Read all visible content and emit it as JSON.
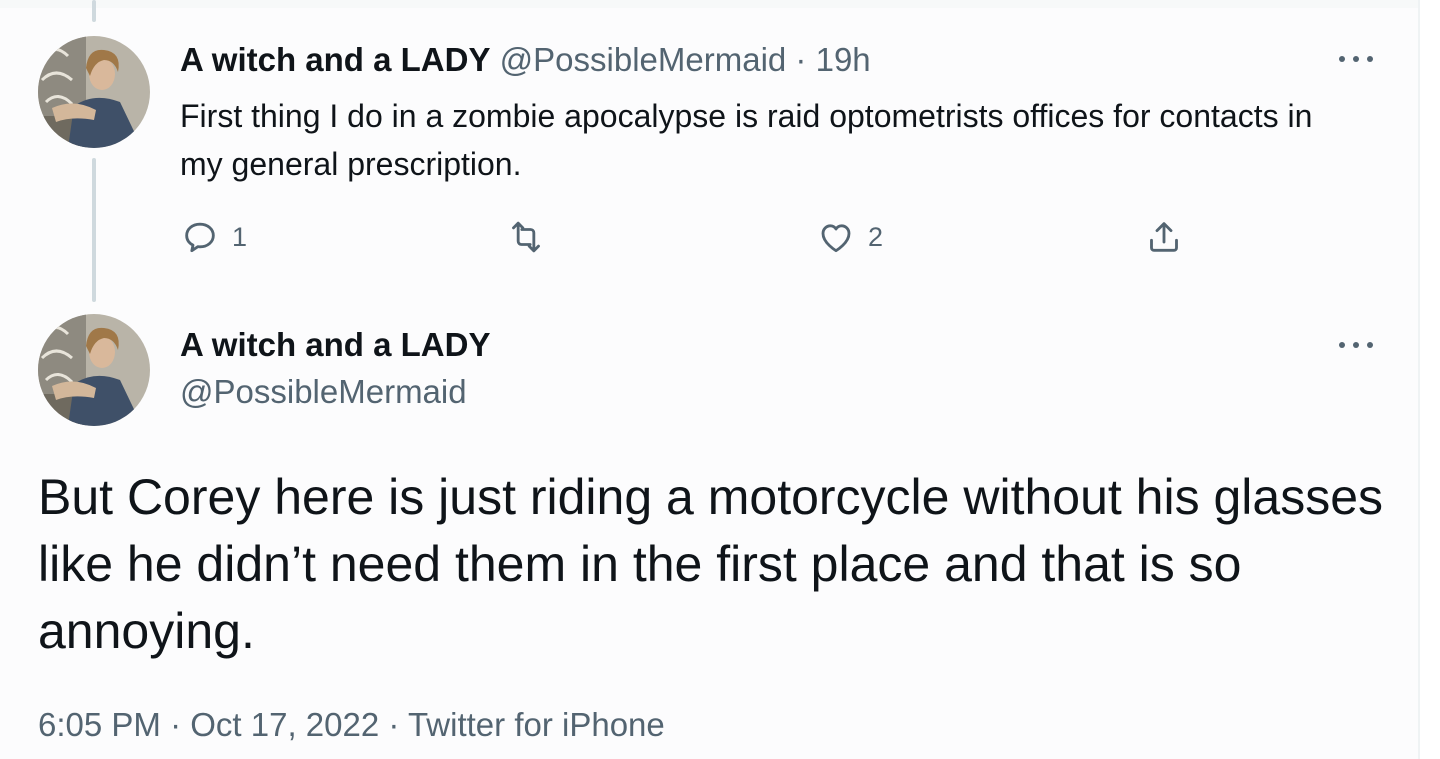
{
  "tweet_reply_parent": {
    "display_name": "A witch and a LADY",
    "handle": "@PossibleMermaid",
    "separator": "·",
    "time_ago": "19h",
    "text": "First thing I do in a zombie apocalypse is raid optometrists offices for contacts in my general prescription.",
    "reply_count": "1",
    "retweet_count": "",
    "like_count": "2",
    "icons": [
      "reply-icon",
      "retweet-icon",
      "like-icon",
      "share-icon",
      "more-icon"
    ]
  },
  "tweet_main": {
    "display_name": "A witch and a LADY",
    "handle": "@PossibleMermaid",
    "text": "But Corey here is just riding a motorcycle without his glasses like he didn’t need them in the first place and that is so annoying.",
    "time": "6:05 PM",
    "date": "Oct 17, 2022",
    "source": "Twitter for iPhone",
    "separator": "·"
  },
  "colors": {
    "text": "#0f1419",
    "muted": "#536471",
    "thread_line": "#cfd9de",
    "border": "#eff3f4"
  }
}
